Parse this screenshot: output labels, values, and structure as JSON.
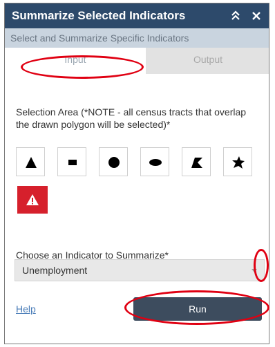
{
  "widget": {
    "title": "Summarize Selected Indicators",
    "subtitle": "Select and Summarize Specific Indicators"
  },
  "tabs": [
    {
      "label": "Input",
      "active": true
    },
    {
      "label": "Output",
      "active": false
    }
  ],
  "selection": {
    "label": "Selection Area (*NOTE - all census tracts that overlap the drawn polygon will be selected)*",
    "tools": [
      "point",
      "line",
      "circle",
      "ellipse",
      "polygon",
      "freehand-polygon"
    ]
  },
  "indicator": {
    "label": "Choose an Indicator to Summarize*",
    "selected": "Unemployment"
  },
  "actions": {
    "help": "Help",
    "run": "Run"
  },
  "colors": {
    "titlebar": "#2d4a6b",
    "subtitle_bar": "#c9d4df",
    "clear_button": "#d6202c",
    "run_button": "#3d4c5e",
    "annotation": "#e00012",
    "link": "#4a7db8"
  }
}
